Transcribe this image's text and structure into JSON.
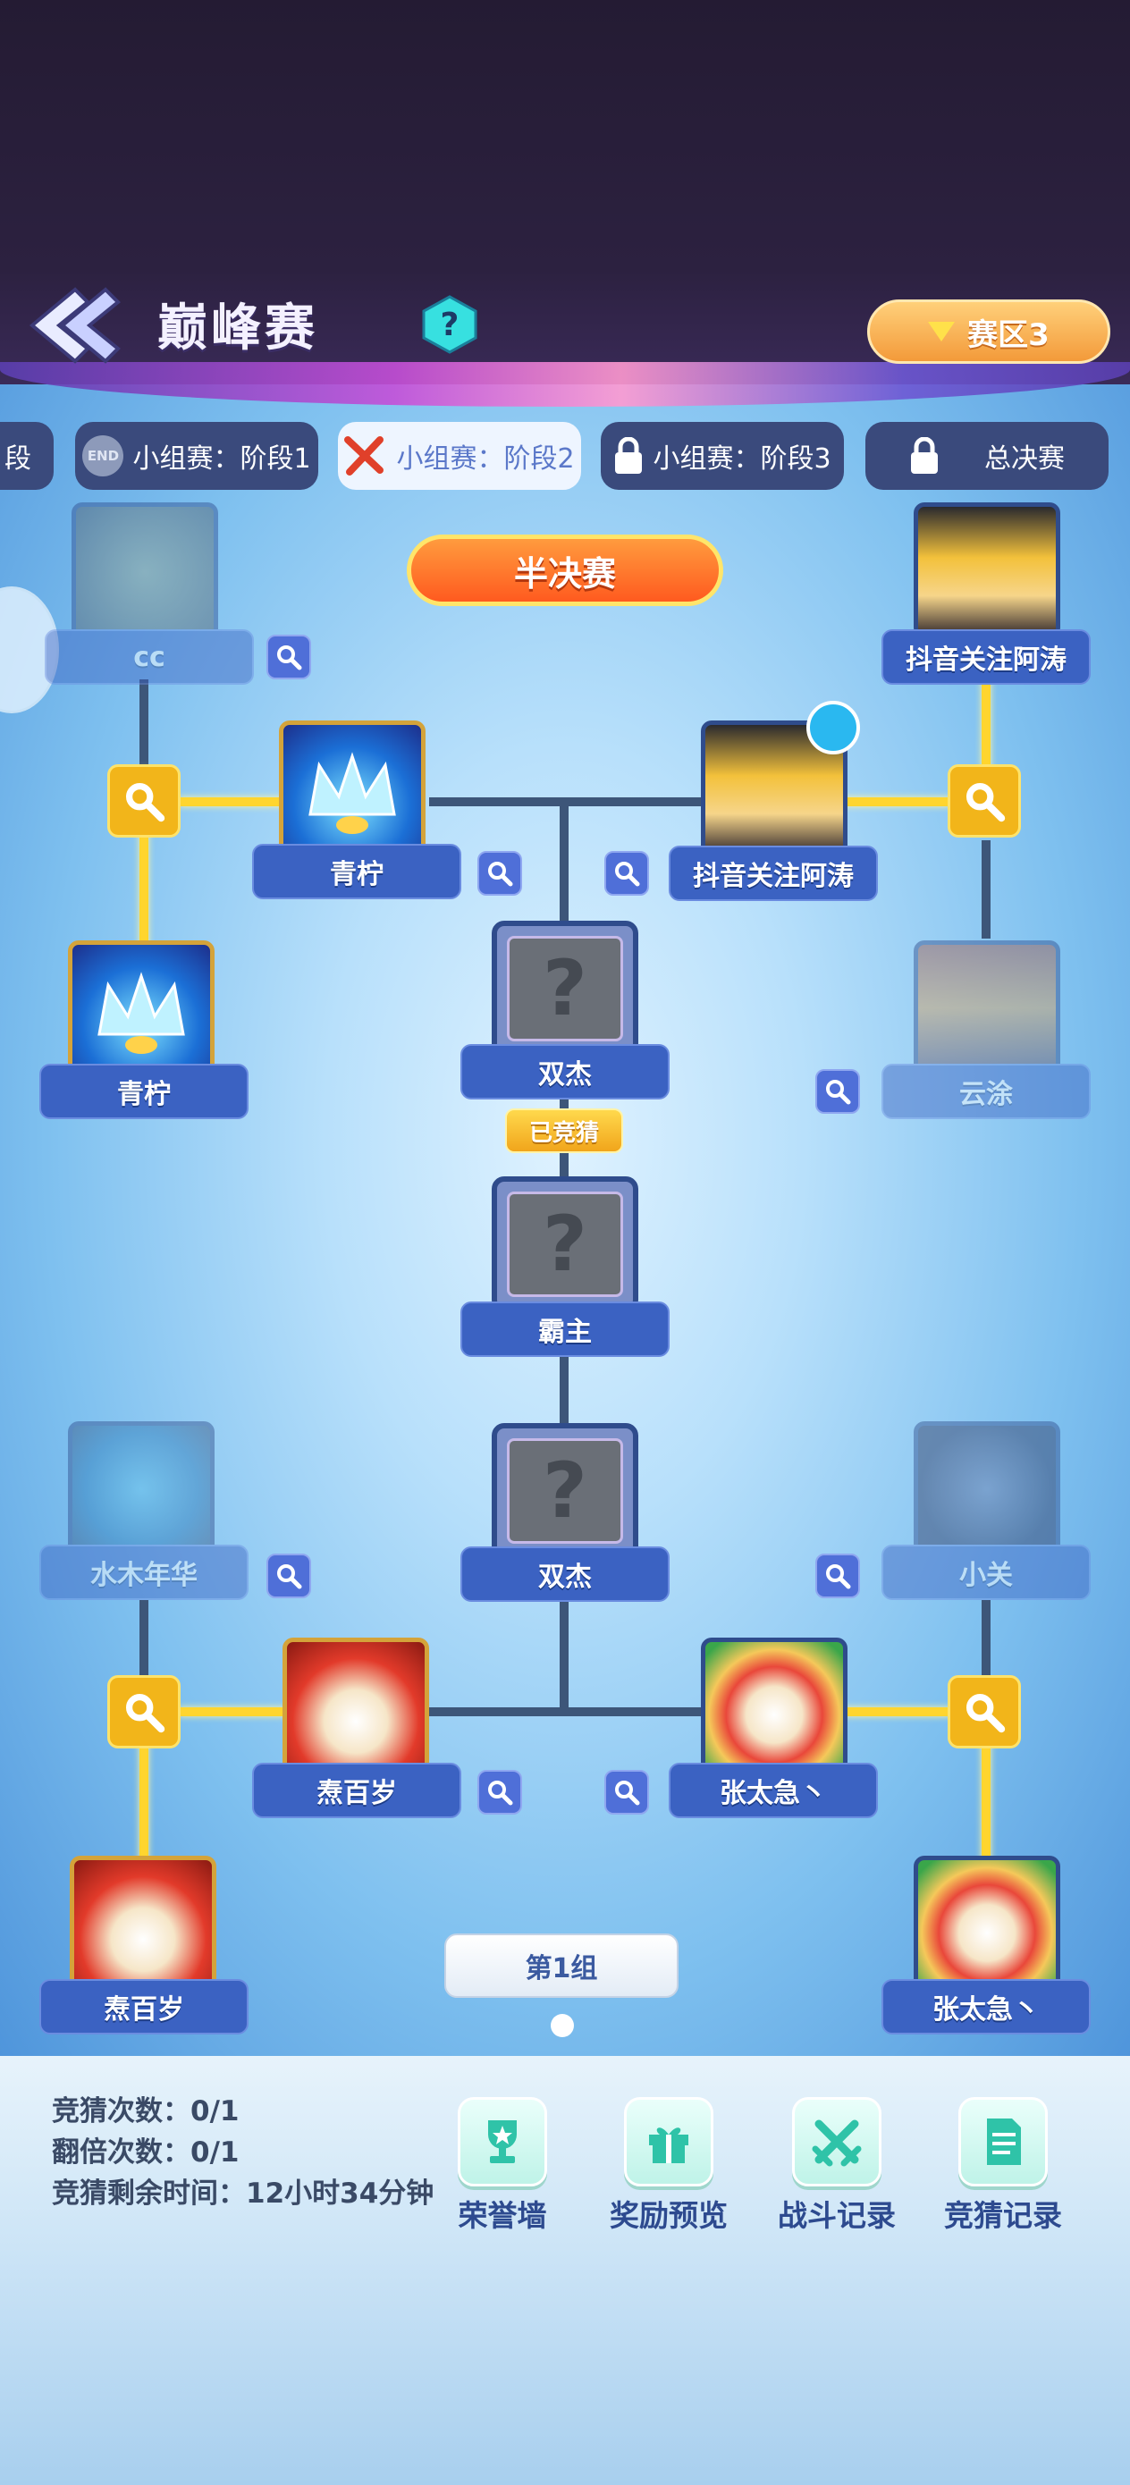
{
  "header": {
    "title": "巅峰赛",
    "help_glyph": "?",
    "region_label": "赛区3"
  },
  "tabs": [
    {
      "label": "段",
      "state": "partial"
    },
    {
      "label": "小组赛：阶段1",
      "badge": "END",
      "state": "ended"
    },
    {
      "label": "小组赛：阶段2",
      "state": "active"
    },
    {
      "label": "小组赛：阶段3",
      "state": "locked"
    },
    {
      "label": "总决赛",
      "state": "locked"
    }
  ],
  "round_banner": "半决赛",
  "bracket": {
    "top": {
      "left_r1_a": "cc",
      "left_r1_b": "青柠",
      "left_r2": "青柠",
      "right_r1_a": "抖音关注阿涛",
      "right_r1_b": "云涂",
      "right_r2": "抖音关注阿涛",
      "finalist": "双杰"
    },
    "champion": "霸主",
    "guessed_badge": "已竞猜",
    "bottom": {
      "left_r1_a": "水木年华",
      "left_r1_b": "焘百岁",
      "left_r2": "焘百岁",
      "right_r1_a": "小关",
      "right_r1_b": "张太急丶",
      "right_r2": "张太急丶",
      "finalist": "双杰"
    },
    "question_glyph": "?"
  },
  "group_label": "第1组",
  "stats": {
    "guess_count": "竞猜次数：0/1",
    "double_count": "翻倍次数：0/1",
    "time_left": "竞猜剩余时间：12小时34分钟"
  },
  "actions": [
    {
      "label": "荣誉墙",
      "icon": "trophy-icon"
    },
    {
      "label": "奖励预览",
      "icon": "gift-icon"
    },
    {
      "label": "战斗记录",
      "icon": "crossed-swords-icon"
    },
    {
      "label": "竞猜记录",
      "icon": "document-icon"
    }
  ],
  "colors": {
    "accent_orange": "#ff7a2e",
    "bracket_line": "#3d5679",
    "winner_line": "#ffd52e",
    "plate_blue": "#3b62c2"
  }
}
